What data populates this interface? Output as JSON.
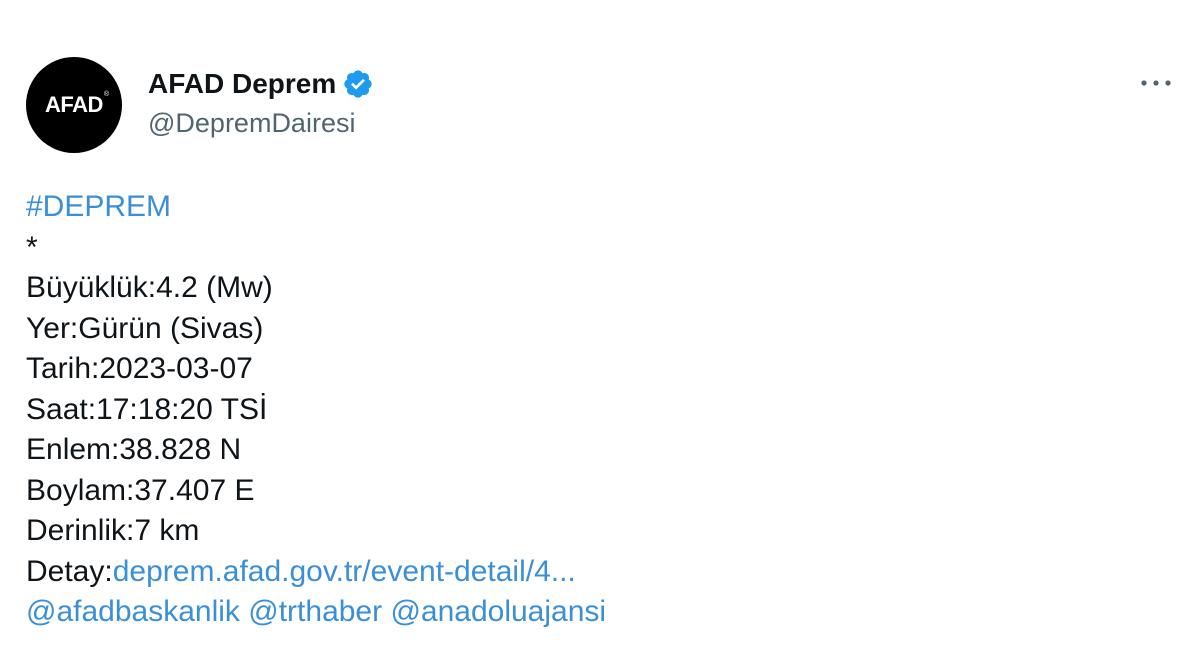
{
  "author": {
    "avatar_text": "AFAD",
    "avatar_reg_mark": "®",
    "display_name": "AFAD Deprem",
    "handle": "@DepremDairesi",
    "verified": true
  },
  "icons": {
    "verified": "verified-badge-icon",
    "more": "more-options-icon"
  },
  "colors": {
    "link": "#3a8fd6",
    "verified_badge": "#1d9bf0",
    "handle": "#536471",
    "text": "#0f1419",
    "avatar_bg": "#000000"
  },
  "tweet": {
    "hashtag": "#DEPREM",
    "separator": "*",
    "magnitude": "Büyüklük:4.2 (Mw)",
    "location": "Yer:Gürün (Sivas)",
    "date": "Tarih:2023-03-07",
    "time": "Saat:17:18:20 TSİ",
    "latitude": "Enlem:38.828 N",
    "longitude": "Boylam:37.407 E",
    "depth": "Derinlik:7 km",
    "detail_label": "Detay:",
    "detail_link": "deprem.afad.gov.tr/event-detail/4...",
    "mentions": [
      "@afadbaskanlik",
      "@trthaber",
      "@anadoluajansi"
    ]
  }
}
